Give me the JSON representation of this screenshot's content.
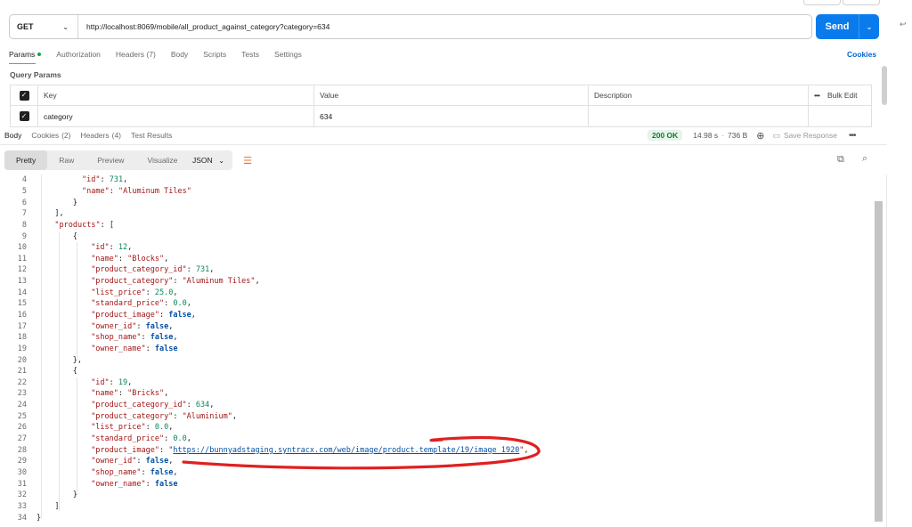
{
  "request": {
    "method": "GET",
    "url": "http://localhost:8069/mobile/all_product_against_category?category=634",
    "send_label": "Send",
    "tabs": [
      {
        "label": "Params",
        "dot": true
      },
      {
        "label": "Authorization"
      },
      {
        "label": "Headers (7)"
      },
      {
        "label": "Body"
      },
      {
        "label": "Scripts"
      },
      {
        "label": "Tests"
      },
      {
        "label": "Settings"
      }
    ],
    "cookies_label": "Cookies"
  },
  "query_params": {
    "title": "Query Params",
    "headers": {
      "key": "Key",
      "value": "Value",
      "description": "Description",
      "bulk_edit": "Bulk Edit"
    },
    "rows": [
      {
        "checked": true,
        "key": "category",
        "value": "634",
        "description": ""
      }
    ]
  },
  "response": {
    "tabs": [
      {
        "label": "Body"
      },
      {
        "label": "Cookies",
        "count": "(2)"
      },
      {
        "label": "Headers",
        "count": "(4)"
      },
      {
        "label": "Test Results"
      }
    ],
    "status": "200 OK",
    "time": "14.98 s",
    "size": "736 B",
    "save_label": "Save Response",
    "view_tabs": [
      "Pretty",
      "Raw",
      "Preview",
      "Visualize"
    ],
    "format": "JSON"
  },
  "code_lines": [
    {
      "n": "4",
      "indent": 10,
      "tokens": [
        {
          "t": "k",
          "v": "\"id\""
        },
        {
          "t": "p",
          "v": ": "
        },
        {
          "t": "n",
          "v": "731"
        },
        {
          "t": "p",
          "v": ","
        }
      ]
    },
    {
      "n": "5",
      "indent": 10,
      "tokens": [
        {
          "t": "k",
          "v": "\"name\""
        },
        {
          "t": "p",
          "v": ": "
        },
        {
          "t": "s",
          "v": "\"Aluminum Tiles\""
        }
      ]
    },
    {
      "n": "6",
      "indent": 8,
      "tokens": [
        {
          "t": "p",
          "v": "}"
        }
      ]
    },
    {
      "n": "7",
      "indent": 4,
      "tokens": [
        {
          "t": "p",
          "v": "],"
        }
      ]
    },
    {
      "n": "8",
      "indent": 4,
      "tokens": [
        {
          "t": "k",
          "v": "\"products\""
        },
        {
          "t": "p",
          "v": ": ["
        }
      ]
    },
    {
      "n": "9",
      "indent": 8,
      "tokens": [
        {
          "t": "p",
          "v": "{"
        }
      ]
    },
    {
      "n": "10",
      "indent": 12,
      "tokens": [
        {
          "t": "k",
          "v": "\"id\""
        },
        {
          "t": "p",
          "v": ": "
        },
        {
          "t": "n",
          "v": "12"
        },
        {
          "t": "p",
          "v": ","
        }
      ]
    },
    {
      "n": "11",
      "indent": 12,
      "tokens": [
        {
          "t": "k",
          "v": "\"name\""
        },
        {
          "t": "p",
          "v": ": "
        },
        {
          "t": "s",
          "v": "\"Blocks\""
        },
        {
          "t": "p",
          "v": ","
        }
      ]
    },
    {
      "n": "12",
      "indent": 12,
      "tokens": [
        {
          "t": "k",
          "v": "\"product_category_id\""
        },
        {
          "t": "p",
          "v": ": "
        },
        {
          "t": "n",
          "v": "731"
        },
        {
          "t": "p",
          "v": ","
        }
      ]
    },
    {
      "n": "13",
      "indent": 12,
      "tokens": [
        {
          "t": "k",
          "v": "\"product_category\""
        },
        {
          "t": "p",
          "v": ": "
        },
        {
          "t": "s",
          "v": "\"Aluminum Tiles\""
        },
        {
          "t": "p",
          "v": ","
        }
      ]
    },
    {
      "n": "14",
      "indent": 12,
      "tokens": [
        {
          "t": "k",
          "v": "\"list_price\""
        },
        {
          "t": "p",
          "v": ": "
        },
        {
          "t": "n",
          "v": "25.0"
        },
        {
          "t": "p",
          "v": ","
        }
      ]
    },
    {
      "n": "15",
      "indent": 12,
      "tokens": [
        {
          "t": "k",
          "v": "\"standard_price\""
        },
        {
          "t": "p",
          "v": ": "
        },
        {
          "t": "n",
          "v": "0.0"
        },
        {
          "t": "p",
          "v": ","
        }
      ]
    },
    {
      "n": "16",
      "indent": 12,
      "tokens": [
        {
          "t": "k",
          "v": "\"product_image\""
        },
        {
          "t": "p",
          "v": ": "
        },
        {
          "t": "b",
          "v": "false"
        },
        {
          "t": "p",
          "v": ","
        }
      ]
    },
    {
      "n": "17",
      "indent": 12,
      "tokens": [
        {
          "t": "k",
          "v": "\"owner_id\""
        },
        {
          "t": "p",
          "v": ": "
        },
        {
          "t": "b",
          "v": "false"
        },
        {
          "t": "p",
          "v": ","
        }
      ]
    },
    {
      "n": "18",
      "indent": 12,
      "tokens": [
        {
          "t": "k",
          "v": "\"shop_name\""
        },
        {
          "t": "p",
          "v": ": "
        },
        {
          "t": "b",
          "v": "false"
        },
        {
          "t": "p",
          "v": ","
        }
      ]
    },
    {
      "n": "19",
      "indent": 12,
      "tokens": [
        {
          "t": "k",
          "v": "\"owner_name\""
        },
        {
          "t": "p",
          "v": ": "
        },
        {
          "t": "b",
          "v": "false"
        }
      ]
    },
    {
      "n": "20",
      "indent": 8,
      "tokens": [
        {
          "t": "p",
          "v": "},"
        }
      ]
    },
    {
      "n": "21",
      "indent": 8,
      "tokens": [
        {
          "t": "p",
          "v": "{"
        }
      ]
    },
    {
      "n": "22",
      "indent": 12,
      "tokens": [
        {
          "t": "k",
          "v": "\"id\""
        },
        {
          "t": "p",
          "v": ": "
        },
        {
          "t": "n",
          "v": "19"
        },
        {
          "t": "p",
          "v": ","
        }
      ]
    },
    {
      "n": "23",
      "indent": 12,
      "tokens": [
        {
          "t": "k",
          "v": "\"name\""
        },
        {
          "t": "p",
          "v": ": "
        },
        {
          "t": "s",
          "v": "\"Bricks\""
        },
        {
          "t": "p",
          "v": ","
        }
      ]
    },
    {
      "n": "24",
      "indent": 12,
      "tokens": [
        {
          "t": "k",
          "v": "\"product_category_id\""
        },
        {
          "t": "p",
          "v": ": "
        },
        {
          "t": "n",
          "v": "634"
        },
        {
          "t": "p",
          "v": ","
        }
      ]
    },
    {
      "n": "25",
      "indent": 12,
      "tokens": [
        {
          "t": "k",
          "v": "\"product_category\""
        },
        {
          "t": "p",
          "v": ": "
        },
        {
          "t": "s",
          "v": "\"Aluminium\""
        },
        {
          "t": "p",
          "v": ","
        }
      ]
    },
    {
      "n": "26",
      "indent": 12,
      "tokens": [
        {
          "t": "k",
          "v": "\"list_price\""
        },
        {
          "t": "p",
          "v": ": "
        },
        {
          "t": "n",
          "v": "0.0"
        },
        {
          "t": "p",
          "v": ","
        }
      ]
    },
    {
      "n": "27",
      "indent": 12,
      "tokens": [
        {
          "t": "k",
          "v": "\"standard_price\""
        },
        {
          "t": "p",
          "v": ": "
        },
        {
          "t": "n",
          "v": "0.0"
        },
        {
          "t": "p",
          "v": ","
        }
      ]
    },
    {
      "n": "28",
      "indent": 12,
      "tokens": [
        {
          "t": "k",
          "v": "\"product_image\""
        },
        {
          "t": "p",
          "v": ": "
        },
        {
          "t": "s",
          "v": "\""
        },
        {
          "t": "url",
          "v": "https://bunnyadstaging.syntracx.com/web/image/product.template/19/image_1920"
        },
        {
          "t": "s",
          "v": "\""
        },
        {
          "t": "p",
          "v": ","
        }
      ]
    },
    {
      "n": "29",
      "indent": 12,
      "tokens": [
        {
          "t": "k",
          "v": "\"owner_id\""
        },
        {
          "t": "p",
          "v": ": "
        },
        {
          "t": "b",
          "v": "false"
        },
        {
          "t": "p",
          "v": ","
        }
      ]
    },
    {
      "n": "30",
      "indent": 12,
      "tokens": [
        {
          "t": "k",
          "v": "\"shop_name\""
        },
        {
          "t": "p",
          "v": ": "
        },
        {
          "t": "b",
          "v": "false"
        },
        {
          "t": "p",
          "v": ","
        }
      ]
    },
    {
      "n": "31",
      "indent": 12,
      "tokens": [
        {
          "t": "k",
          "v": "\"owner_name\""
        },
        {
          "t": "p",
          "v": ": "
        },
        {
          "t": "b",
          "v": "false"
        }
      ]
    },
    {
      "n": "32",
      "indent": 8,
      "tokens": [
        {
          "t": "p",
          "v": "}"
        }
      ]
    },
    {
      "n": "33",
      "indent": 4,
      "tokens": [
        {
          "t": "p",
          "v": "]"
        }
      ]
    },
    {
      "n": "34",
      "indent": 0,
      "tokens": [
        {
          "t": "p",
          "v": "}"
        }
      ]
    }
  ],
  "colors": {
    "send_button": "#097bed",
    "active_tab_underline": "#f26b3a",
    "status_ok": "#107c2f",
    "annotation_stroke": "#e02020"
  },
  "icons": {
    "method_dropdown": "chevron-down-icon",
    "checkbox": "check-icon",
    "globe": "globe-icon",
    "save": "save-icon",
    "more": "more-icon",
    "copy": "copy-icon",
    "search": "search-icon",
    "wrap": "wrap-lines-icon"
  }
}
